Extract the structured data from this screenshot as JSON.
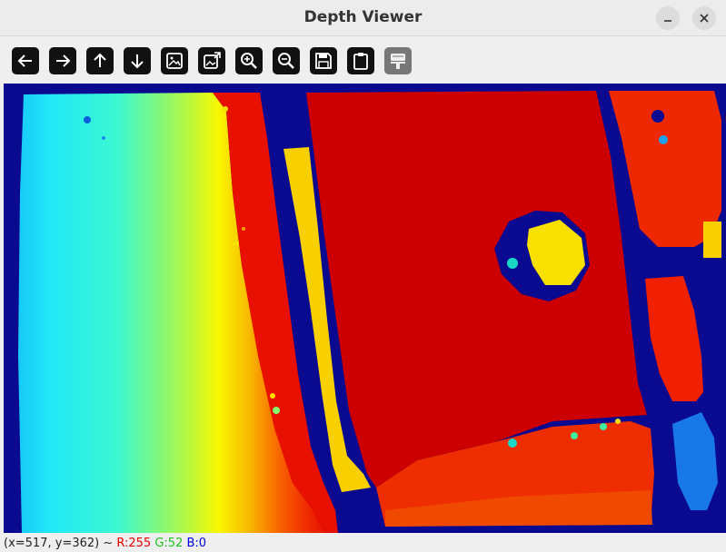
{
  "window": {
    "title": "Depth Viewer",
    "minimize_icon": "minimize-icon",
    "close_icon": "close-icon"
  },
  "toolbar": {
    "buttons": [
      {
        "name": "pan-left-button",
        "icon": "arrow-left-icon"
      },
      {
        "name": "pan-right-button",
        "icon": "arrow-right-icon"
      },
      {
        "name": "pan-up-button",
        "icon": "arrow-up-icon"
      },
      {
        "name": "pan-down-button",
        "icon": "arrow-down-icon"
      },
      {
        "name": "zoom-to-image-button",
        "icon": "image-icon"
      },
      {
        "name": "zoom-to-image-fit-button",
        "icon": "image-fit-icon"
      },
      {
        "name": "zoom-in-button",
        "icon": "zoom-in-icon"
      },
      {
        "name": "zoom-out-button",
        "icon": "zoom-out-icon"
      },
      {
        "name": "save-button",
        "icon": "save-icon"
      },
      {
        "name": "copy-to-clipboard-button",
        "icon": "clipboard-icon"
      },
      {
        "name": "properties-button",
        "icon": "paint-icon"
      }
    ]
  },
  "image": {
    "description_colormap": "jet"
  },
  "status": {
    "coords": "(x=517, y=362) ~ ",
    "r": "R:255",
    "g": "G:52",
    "b": "B:0"
  },
  "colors": {
    "background": "#0a0a90",
    "deep_red": "#cc0000",
    "red": "#e81000",
    "orange_red": "#f03000",
    "yellow": "#f8e000",
    "cyan": "#20f0f8",
    "blue": "#0a0a90"
  }
}
